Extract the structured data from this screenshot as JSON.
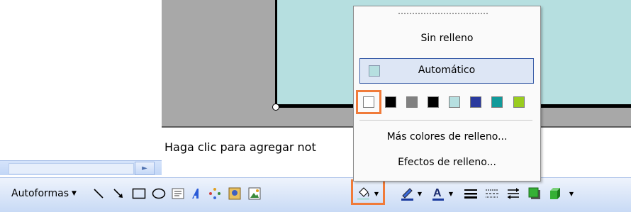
{
  "notes": {
    "placeholder": "Haga clic para agregar not"
  },
  "fill_menu": {
    "no_fill": "Sin relleno",
    "automatic": "Automático",
    "swatches": [
      "#ffffff",
      "#000000",
      "#808080",
      "#000000",
      "#b6dfe0",
      "#2a3a9e",
      "#119a9a",
      "#99cc1f"
    ],
    "more_colors": "Más colores de relleno...",
    "fill_effects": "Efectos de relleno..."
  },
  "drawing_toolbar": {
    "autoshapes_label": "Autoformas"
  },
  "colors": {
    "highlight": "#f07b3a",
    "slide_fill": "#b6dfe0"
  }
}
